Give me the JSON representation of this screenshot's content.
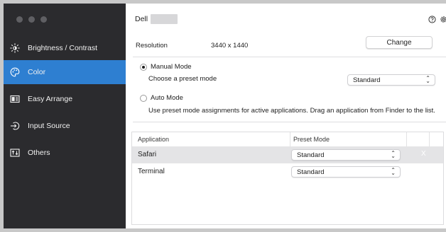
{
  "sidebar": {
    "items": [
      {
        "label": "Brightness / Contrast",
        "icon": "brightness-icon",
        "active": false
      },
      {
        "label": "Color",
        "icon": "color-palette-icon",
        "active": true
      },
      {
        "label": "Easy Arrange",
        "icon": "easy-arrange-icon",
        "active": false
      },
      {
        "label": "Input Source",
        "icon": "input-source-icon",
        "active": false
      },
      {
        "label": "Others",
        "icon": "others-icon",
        "active": false
      }
    ]
  },
  "header": {
    "brand": "Dell",
    "help_icon": "help-circle-icon",
    "settings_icon": "gear-icon"
  },
  "resolution": {
    "label": "Resolution",
    "value": "3440 x 1440",
    "change_label": "Change"
  },
  "manual_mode": {
    "label": "Manual Mode",
    "selected": true,
    "preset_prompt": "Choose a preset mode",
    "preset_value": "Standard"
  },
  "auto_mode": {
    "label": "Auto Mode",
    "selected": false,
    "description": "Use preset mode assignments for active applications. Drag an application from Finder to the list."
  },
  "app_table": {
    "headers": [
      "Application",
      "Preset Mode"
    ],
    "rows": [
      {
        "application": "Safari",
        "preset": "Standard",
        "remove": "X"
      },
      {
        "application": "Terminal",
        "preset": "Standard"
      }
    ]
  },
  "colors": {
    "sidebar_bg": "#2b2b2e",
    "accent": "#2e7fd1",
    "row_highlight": "#e4e4e6"
  }
}
